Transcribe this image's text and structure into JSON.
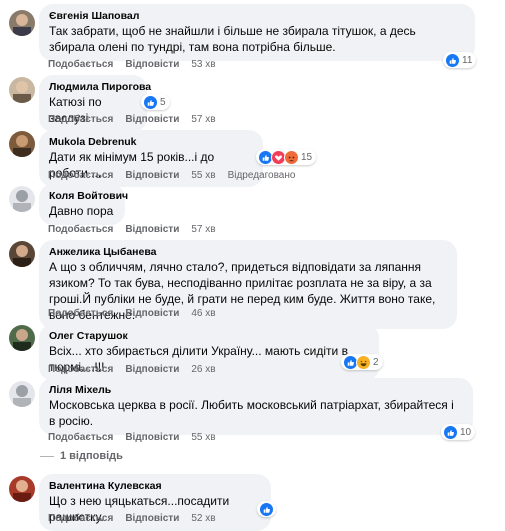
{
  "actions": {
    "like": "Подобається",
    "reply": "Відповісти"
  },
  "comments": [
    {
      "name": "Євгенія Шаповал",
      "text": "Так забрати, щоб не знайшли і більше не збирала тітушок, а десь збирала олені по тундрі, там вона потрібна більше.",
      "time": "53 хв",
      "reactions": "11",
      "reaction_icons": [
        "like-icon"
      ]
    },
    {
      "name": "Людмила Пирогова",
      "text": "Катюзі по заслузі",
      "time": "57 хв",
      "reactions": "5",
      "reaction_icons": [
        "like-icon"
      ]
    },
    {
      "name": "Mukola Debrenuk",
      "text": "Дати як мінімум 15 років...і до роботи ...",
      "time": "55 хв",
      "edited": "Відредаговано",
      "reactions": "15",
      "reaction_icons": [
        "like-icon",
        "love-icon",
        "angry-icon"
      ]
    },
    {
      "name": "Коля Войтович",
      "text": "Давно пора",
      "time": "57 хв"
    },
    {
      "name": "Анжелика Цыбанева",
      "text": "А що з обличчям, лячно стало?, придеться відповідати за ляпання язиком? То так бува, несподіванно прилітає розплата не за віру, а за гроші.Й публіки не буде, й грати не перед ким буде. Життя воно таке, воно бентежне.",
      "time": "46 хв"
    },
    {
      "name": "Олег Старушок",
      "text": "Всіх... хто збирається ділити Україну... мають сидіти в тюрмі....!!!",
      "time": "26 хв",
      "reactions": "2",
      "reaction_icons": [
        "like-icon",
        "haha-icon"
      ]
    },
    {
      "name": "Ліля Міхель",
      "text": "Московська церква в росії. Любить московський патріархат, збирайтеся і в росію.",
      "time": "55 хв",
      "reactions": "10",
      "reaction_icons": [
        "like-icon"
      ],
      "replies": "1 відповідь"
    },
    {
      "name": "Валентина Кулевская",
      "text": "Що з нею цяцькаться...посадити рашистку.",
      "time": "52 хв",
      "reaction_icons": [
        "like-icon"
      ]
    }
  ]
}
